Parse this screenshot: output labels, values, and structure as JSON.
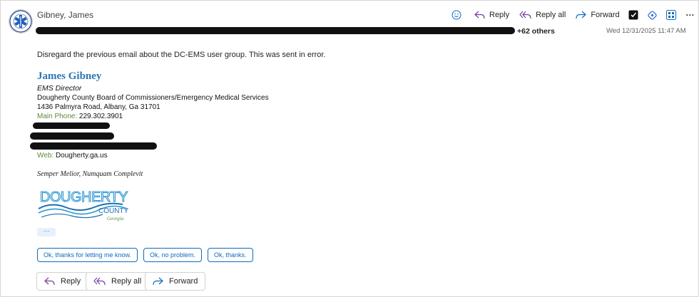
{
  "sender": {
    "name": "Gibney, James"
  },
  "recipients": {
    "others_label": "+62 others"
  },
  "date": "Wed 12/31/2025 11:47 AM",
  "toolbar": {
    "reply": "Reply",
    "reply_all": "Reply all",
    "forward": "Forward",
    "more": "···"
  },
  "message": {
    "body": "Disregard the previous email about the DC-EMS user group.  This was sent in error."
  },
  "signature": {
    "name": "James Gibney",
    "title": "EMS Director",
    "org": "Dougherty County Board of Commissioners/Emergency Medical Services",
    "address": "1436 Palmyra Road, Albany, Ga 31701",
    "phone_label": "Main Phone:",
    "phone": " 229.302.3901",
    "web_label": "Web:",
    "web": " Dougherty.ga.us",
    "motto": "Semper Melior, Numquam Complevit"
  },
  "logo": {
    "word1": "DOUGHERTY",
    "word2": "COUNTY",
    "word3": "Georgia"
  },
  "more_pill": "···",
  "quick_replies": [
    "Ok, thanks for letting me know.",
    "Ok, no problem.",
    "Ok, thanks."
  ],
  "actions": {
    "reply": "Reply",
    "reply_all": "Reply all",
    "forward": "Forward"
  },
  "colors": {
    "accent": "#0f6cbd",
    "signature_name": "#2e74b5",
    "signature_green": "#5a8a3a"
  }
}
